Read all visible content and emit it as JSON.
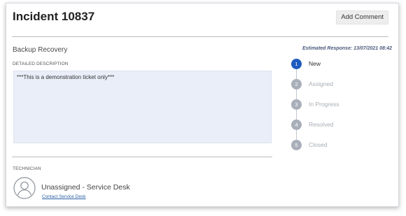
{
  "incident": {
    "title": "Incident 10837",
    "add_comment_label": "Add Comment",
    "subject": "Backup Recovery",
    "description_label": "DETAILED DESCRIPTION",
    "description": "***This is a demonstration ticket only***",
    "estimated_response": "Estimated Response: 13/07/2021 08:42"
  },
  "technician": {
    "label": "TECHNICIAN",
    "name": "Unassigned - Service Desk",
    "contact_link": "Contact Service Desk",
    "avatar_icon": "user-avatar-icon"
  },
  "status_steps": [
    {
      "number": "1",
      "label": "New",
      "active": true
    },
    {
      "number": "2",
      "label": "Assigned",
      "active": false
    },
    {
      "number": "3",
      "label": "In Progress",
      "active": false
    },
    {
      "number": "4",
      "label": "Resolved",
      "active": false
    },
    {
      "number": "5",
      "label": "Closed",
      "active": false
    }
  ],
  "colors": {
    "accent": "#1f5bbf",
    "inactive_step": "#a8afb9",
    "description_bg": "#e9eef8",
    "link": "#2b5fa6"
  }
}
